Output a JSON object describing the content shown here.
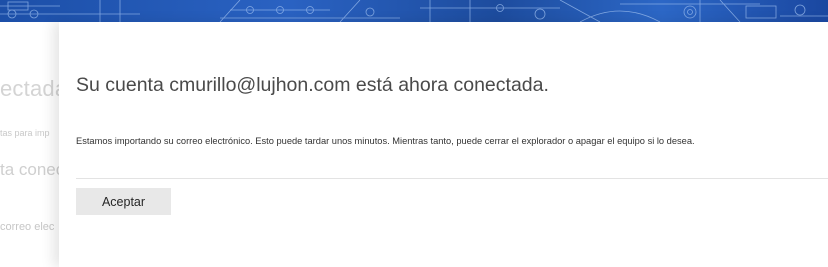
{
  "background": {
    "heading_fragment": "ectadas",
    "small_fragment": "tas para imp",
    "sub_fragment": "ta conec",
    "small_fragment_2": "correo elec"
  },
  "dialog": {
    "title": "Su cuenta cmurillo@lujhon.com está ahora conectada.",
    "body": "Estamos importando su correo electrónico. Esto puede tardar unos minutos. Mientras tanto, puede cerrar el explorador o apagar el equipo si lo desea.",
    "accept_label": "Aceptar"
  },
  "colors": {
    "banner_blue": "#1c4fa8",
    "button_bg": "#e8e8e8",
    "title_text": "#4a4a4a"
  }
}
